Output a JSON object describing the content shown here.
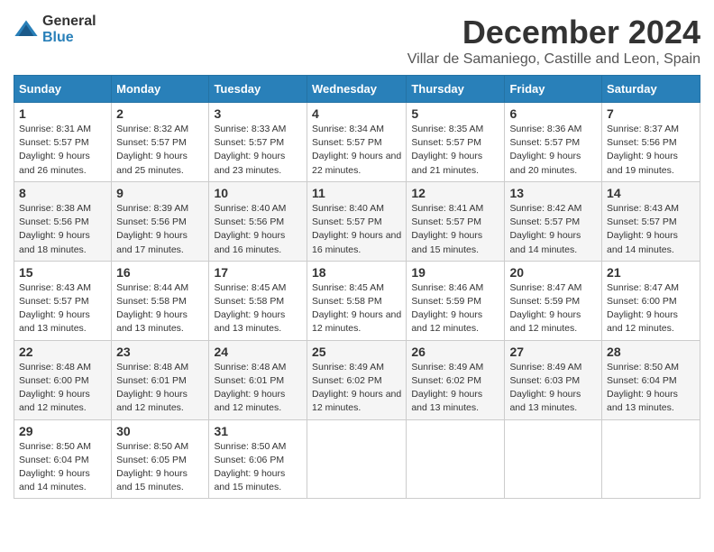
{
  "logo": {
    "general": "General",
    "blue": "Blue"
  },
  "title": "December 2024",
  "subtitle": "Villar de Samaniego, Castille and Leon, Spain",
  "calendar": {
    "headers": [
      "Sunday",
      "Monday",
      "Tuesday",
      "Wednesday",
      "Thursday",
      "Friday",
      "Saturday"
    ],
    "rows": [
      [
        {
          "day": "1",
          "info": "Sunrise: 8:31 AM\nSunset: 5:57 PM\nDaylight: 9 hours and 26 minutes."
        },
        {
          "day": "2",
          "info": "Sunrise: 8:32 AM\nSunset: 5:57 PM\nDaylight: 9 hours and 25 minutes."
        },
        {
          "day": "3",
          "info": "Sunrise: 8:33 AM\nSunset: 5:57 PM\nDaylight: 9 hours and 23 minutes."
        },
        {
          "day": "4",
          "info": "Sunrise: 8:34 AM\nSunset: 5:57 PM\nDaylight: 9 hours and 22 minutes."
        },
        {
          "day": "5",
          "info": "Sunrise: 8:35 AM\nSunset: 5:57 PM\nDaylight: 9 hours and 21 minutes."
        },
        {
          "day": "6",
          "info": "Sunrise: 8:36 AM\nSunset: 5:57 PM\nDaylight: 9 hours and 20 minutes."
        },
        {
          "day": "7",
          "info": "Sunrise: 8:37 AM\nSunset: 5:56 PM\nDaylight: 9 hours and 19 minutes."
        }
      ],
      [
        {
          "day": "8",
          "info": "Sunrise: 8:38 AM\nSunset: 5:56 PM\nDaylight: 9 hours and 18 minutes."
        },
        {
          "day": "9",
          "info": "Sunrise: 8:39 AM\nSunset: 5:56 PM\nDaylight: 9 hours and 17 minutes."
        },
        {
          "day": "10",
          "info": "Sunrise: 8:40 AM\nSunset: 5:56 PM\nDaylight: 9 hours and 16 minutes."
        },
        {
          "day": "11",
          "info": "Sunrise: 8:40 AM\nSunset: 5:57 PM\nDaylight: 9 hours and 16 minutes."
        },
        {
          "day": "12",
          "info": "Sunrise: 8:41 AM\nSunset: 5:57 PM\nDaylight: 9 hours and 15 minutes."
        },
        {
          "day": "13",
          "info": "Sunrise: 8:42 AM\nSunset: 5:57 PM\nDaylight: 9 hours and 14 minutes."
        },
        {
          "day": "14",
          "info": "Sunrise: 8:43 AM\nSunset: 5:57 PM\nDaylight: 9 hours and 14 minutes."
        }
      ],
      [
        {
          "day": "15",
          "info": "Sunrise: 8:43 AM\nSunset: 5:57 PM\nDaylight: 9 hours and 13 minutes."
        },
        {
          "day": "16",
          "info": "Sunrise: 8:44 AM\nSunset: 5:58 PM\nDaylight: 9 hours and 13 minutes."
        },
        {
          "day": "17",
          "info": "Sunrise: 8:45 AM\nSunset: 5:58 PM\nDaylight: 9 hours and 13 minutes."
        },
        {
          "day": "18",
          "info": "Sunrise: 8:45 AM\nSunset: 5:58 PM\nDaylight: 9 hours and 12 minutes."
        },
        {
          "day": "19",
          "info": "Sunrise: 8:46 AM\nSunset: 5:59 PM\nDaylight: 9 hours and 12 minutes."
        },
        {
          "day": "20",
          "info": "Sunrise: 8:47 AM\nSunset: 5:59 PM\nDaylight: 9 hours and 12 minutes."
        },
        {
          "day": "21",
          "info": "Sunrise: 8:47 AM\nSunset: 6:00 PM\nDaylight: 9 hours and 12 minutes."
        }
      ],
      [
        {
          "day": "22",
          "info": "Sunrise: 8:48 AM\nSunset: 6:00 PM\nDaylight: 9 hours and 12 minutes."
        },
        {
          "day": "23",
          "info": "Sunrise: 8:48 AM\nSunset: 6:01 PM\nDaylight: 9 hours and 12 minutes."
        },
        {
          "day": "24",
          "info": "Sunrise: 8:48 AM\nSunset: 6:01 PM\nDaylight: 9 hours and 12 minutes."
        },
        {
          "day": "25",
          "info": "Sunrise: 8:49 AM\nSunset: 6:02 PM\nDaylight: 9 hours and 12 minutes."
        },
        {
          "day": "26",
          "info": "Sunrise: 8:49 AM\nSunset: 6:02 PM\nDaylight: 9 hours and 13 minutes."
        },
        {
          "day": "27",
          "info": "Sunrise: 8:49 AM\nSunset: 6:03 PM\nDaylight: 9 hours and 13 minutes."
        },
        {
          "day": "28",
          "info": "Sunrise: 8:50 AM\nSunset: 6:04 PM\nDaylight: 9 hours and 13 minutes."
        }
      ],
      [
        {
          "day": "29",
          "info": "Sunrise: 8:50 AM\nSunset: 6:04 PM\nDaylight: 9 hours and 14 minutes."
        },
        {
          "day": "30",
          "info": "Sunrise: 8:50 AM\nSunset: 6:05 PM\nDaylight: 9 hours and 15 minutes."
        },
        {
          "day": "31",
          "info": "Sunrise: 8:50 AM\nSunset: 6:06 PM\nDaylight: 9 hours and 15 minutes."
        },
        null,
        null,
        null,
        null
      ]
    ]
  }
}
